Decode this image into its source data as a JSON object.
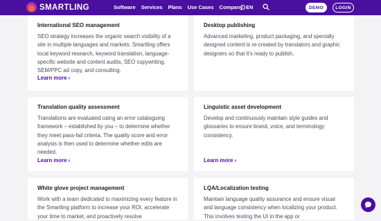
{
  "header": {
    "brand": "SMARTLING",
    "nav": [
      "Software",
      "Services",
      "Plans",
      "Use Cases",
      "Company"
    ],
    "language": "EN",
    "demo_label": "DEMO",
    "login_label": "LOGIN",
    "color": "#4a0fa0"
  },
  "cards": [
    {
      "title": "International SEO management",
      "desc": "SEO strategy increases the organic search visibility of a site in multiple languages and markets. Smartling offers local keyword research, keyword translation, language-specific website and content audits, SEO copywriting, SEM/PPC ad copy, and consulting.",
      "link": "Learn more"
    },
    {
      "title": "Desktop publishing",
      "desc": "Advanced marketing, product packaging, and specially designed content is re-created by translators and graphic designers so that it’s ready to publish."
    },
    {
      "title": "Translation quality assessment",
      "desc": "Translations are evaluated using an error cataloguing framework – established by you – to determine whether they meet pass-fail criteria. The quality score and error analysis is then used to determine whether edits are needed.",
      "link": "Learn more"
    },
    {
      "title": "Linguistic asset development",
      "desc": "Develop and continuously maintain style guides and glossaries to ensure brand, voice, and terminology consistency.",
      "link": "Learn more"
    },
    {
      "title": "White glove project management",
      "desc": "Work with a team dedicated to maximizing every feature in the Smartling platform to increase your ROI, accelerate your time to market, and proactively resolve"
    },
    {
      "title": "LQA/Localization testing",
      "desc": "Maintain language quality assurance and ensure visual and language consistency when localizing your product. This involves testing the UI in the app or"
    }
  ]
}
